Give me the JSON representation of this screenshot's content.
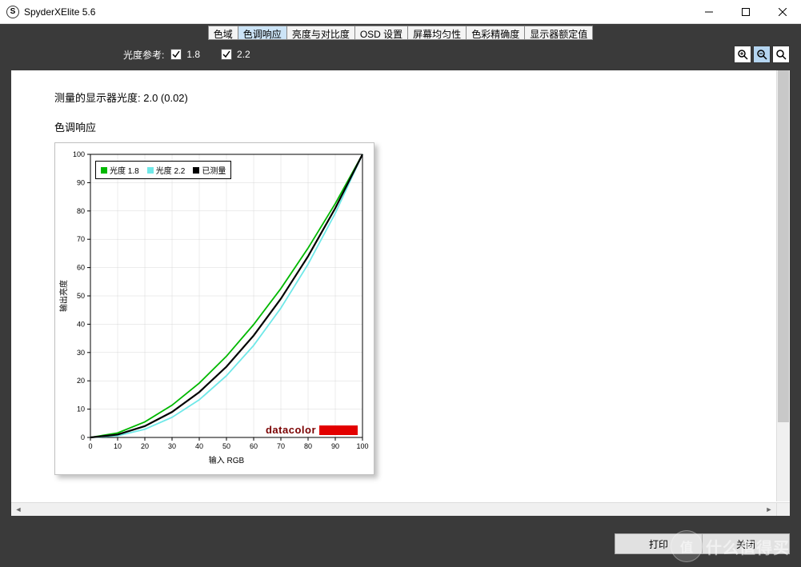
{
  "app": {
    "title": "SpyderXElite 5.6",
    "icon_letter": "S"
  },
  "tabs": {
    "items": [
      {
        "label": "色域"
      },
      {
        "label": "色调响应",
        "active": true
      },
      {
        "label": "亮度与对比度"
      },
      {
        "label": "OSD 设置"
      },
      {
        "label": "屏幕均匀性"
      },
      {
        "label": "色彩精确度"
      },
      {
        "label": "显示器额定值"
      }
    ]
  },
  "controls": {
    "label": "光度参考:",
    "checkboxes": [
      {
        "label": "1.8",
        "checked": true
      },
      {
        "label": "2.2",
        "checked": true
      }
    ]
  },
  "content": {
    "measured_label": "测量的显示器光度:  2.0 (0.02)",
    "chart_title": "色调响应"
  },
  "chart_data": {
    "type": "line",
    "xlabel": "输入 RGB",
    "ylabel": "输出亮度",
    "xlim": [
      0,
      100
    ],
    "ylim": [
      0,
      100
    ],
    "xticks": [
      0,
      10,
      20,
      30,
      40,
      50,
      60,
      70,
      80,
      90,
      100
    ],
    "yticks": [
      0,
      10,
      20,
      30,
      40,
      50,
      60,
      70,
      80,
      90,
      100
    ],
    "series": [
      {
        "name": "光度 1.8",
        "color": "#00b800",
        "x": [
          0,
          10,
          20,
          30,
          40,
          50,
          60,
          70,
          80,
          90,
          100
        ],
        "y": [
          0,
          1.6,
          5.5,
          11.4,
          19.2,
          28.7,
          39.9,
          52.6,
          66.9,
          82.6,
          100
        ]
      },
      {
        "name": "光度 2.2",
        "color": "#6fe8e8",
        "x": [
          0,
          10,
          20,
          30,
          40,
          50,
          60,
          70,
          80,
          90,
          100
        ],
        "y": [
          0,
          0.6,
          2.9,
          7.1,
          13.3,
          21.8,
          32.5,
          45.7,
          61.2,
          79.2,
          100
        ]
      },
      {
        "name": "已测量",
        "color": "#000000",
        "x": [
          0,
          10,
          20,
          30,
          40,
          50,
          60,
          70,
          80,
          90,
          100
        ],
        "y": [
          0,
          1.0,
          4.0,
          9.0,
          16.0,
          25.0,
          36.0,
          49.0,
          64.0,
          81.0,
          100
        ]
      }
    ],
    "brand": "datacolor"
  },
  "footer": {
    "print": "打印",
    "close": "关闭"
  },
  "watermark": {
    "icon": "值",
    "text": "什么值得买"
  }
}
